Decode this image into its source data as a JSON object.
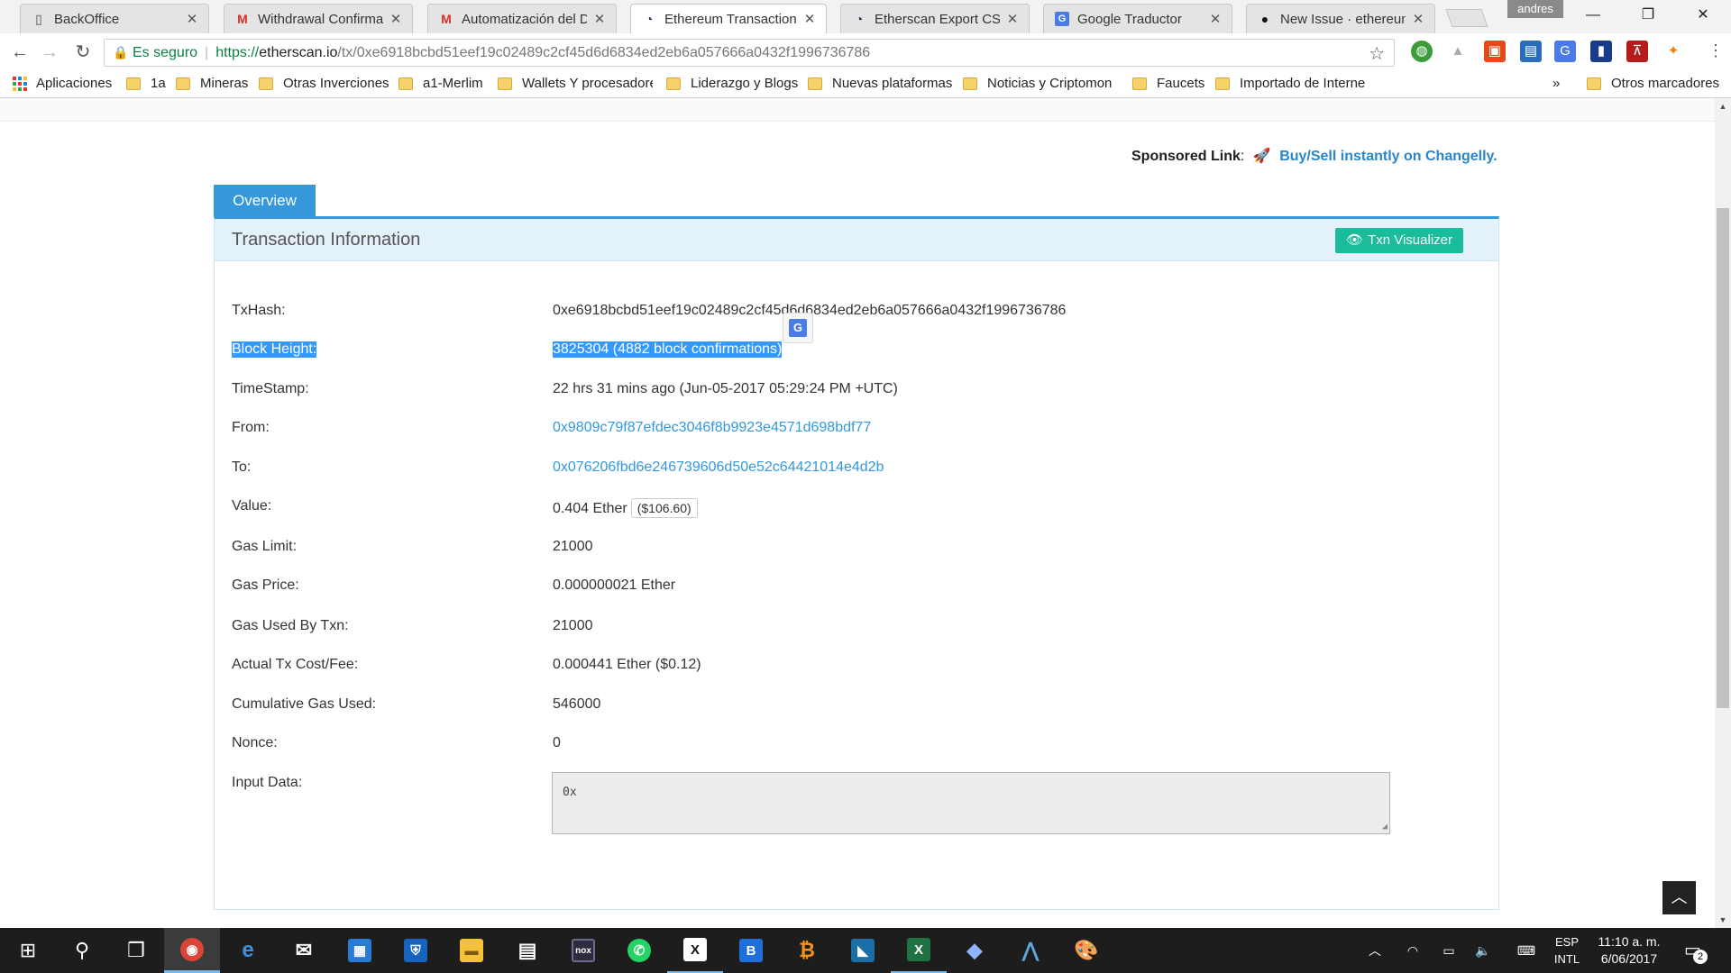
{
  "browser": {
    "tabs": [
      {
        "title": "BackOffice",
        "icon": "page-icon",
        "active": false
      },
      {
        "title": "Withdrawal Confirmati",
        "icon": "gmail-icon",
        "active": false
      },
      {
        "title": "Automatización del De",
        "icon": "gmail-icon",
        "active": false
      },
      {
        "title": "Ethereum Transaction",
        "icon": "etherscan-icon",
        "active": true
      },
      {
        "title": "Etherscan Export CSV D",
        "icon": "etherscan-icon",
        "active": false
      },
      {
        "title": "Google Traductor",
        "icon": "google-translate-icon",
        "active": false
      },
      {
        "title": "New Issue · ethereum/",
        "icon": "github-icon",
        "active": false
      }
    ],
    "close_glyph": "✕",
    "profile_name": "andres",
    "omnibox": {
      "secure_label": "Es seguro",
      "url_scheme": "https://",
      "url_host": "etherscan.io",
      "url_path": "/tx/0xe6918bcbd51eef19c02489c2cf45d6d6834ed2eb6a057666a0432f1996736786"
    },
    "bookmarks": [
      {
        "label": "Aplicaciones",
        "type": "apps"
      },
      {
        "label": "1a",
        "type": "folder"
      },
      {
        "label": "Mineras",
        "type": "folder"
      },
      {
        "label": "Otras Inverciones",
        "type": "folder"
      },
      {
        "label": "a1-Merlim",
        "type": "folder"
      },
      {
        "label": "Wallets Y procesadore",
        "type": "folder"
      },
      {
        "label": "Liderazgo y Blogs",
        "type": "folder"
      },
      {
        "label": "Nuevas plataformas",
        "type": "folder"
      },
      {
        "label": "Noticias y Criptomon",
        "type": "folder"
      },
      {
        "label": "Faucets",
        "type": "folder"
      },
      {
        "label": "Importado de Interne",
        "type": "folder"
      },
      {
        "label": "Otros marcadores",
        "type": "folder"
      }
    ],
    "bookmarks_overflow": "»"
  },
  "page": {
    "sponsored": {
      "prefix": "Sponsored Link",
      "colon": ":",
      "link_text": "Buy/Sell instantly on Changelly."
    },
    "overview_tab": "Overview",
    "panel_title": "Transaction Information",
    "txn_visualizer": "Txn Visualizer",
    "fields": {
      "txhash": {
        "label": "TxHash:",
        "value": "0xe6918bcbd51eef19c02489c2cf45d6d6834ed2eb6a057666a0432f1996736786"
      },
      "block_height": {
        "label": "Block Height:",
        "value": "3825304 (4882 block confirmations)"
      },
      "timestamp": {
        "label": "TimeStamp:",
        "value": "22 hrs 31 mins ago (Jun-05-2017 05:29:24 PM +UTC)"
      },
      "from": {
        "label": "From:",
        "value": "0x9809c79f87efdec3046f8b9923e4571d698bdf77"
      },
      "to": {
        "label": "To:",
        "value": "0x076206fbd6e246739606d50e52c64421014e4d2b"
      },
      "value": {
        "label": "Value:",
        "value": "0.404 Ether",
        "usd": "($106.60)"
      },
      "gas_limit": {
        "label": "Gas Limit:",
        "value": "21000"
      },
      "gas_price": {
        "label": "Gas Price:",
        "value": "0.000000021 Ether"
      },
      "gas_used": {
        "label": "Gas Used By Txn:",
        "value": "21000"
      },
      "tx_fee": {
        "label": "Actual Tx Cost/Fee:",
        "value": "0.000441 Ether ($0.12)"
      },
      "cumulative_gas": {
        "label": "Cumulative Gas Used:",
        "value": "546000"
      },
      "nonce": {
        "label": "Nonce:",
        "value": "0"
      },
      "input_data": {
        "label": "Input Data:",
        "value": "0x"
      }
    }
  },
  "taskbar": {
    "language": {
      "line1": "ESP",
      "line2": "INTL"
    },
    "clock": {
      "time": "11:10 a. m.",
      "date": "6/06/2017"
    },
    "notification_count": "2"
  },
  "colors": {
    "accent": "#3498db",
    "teal_button": "#1abc9c",
    "selection": "#3399ff",
    "panel_head": "#e3f1f9",
    "taskbar": "#1d1d1d"
  }
}
